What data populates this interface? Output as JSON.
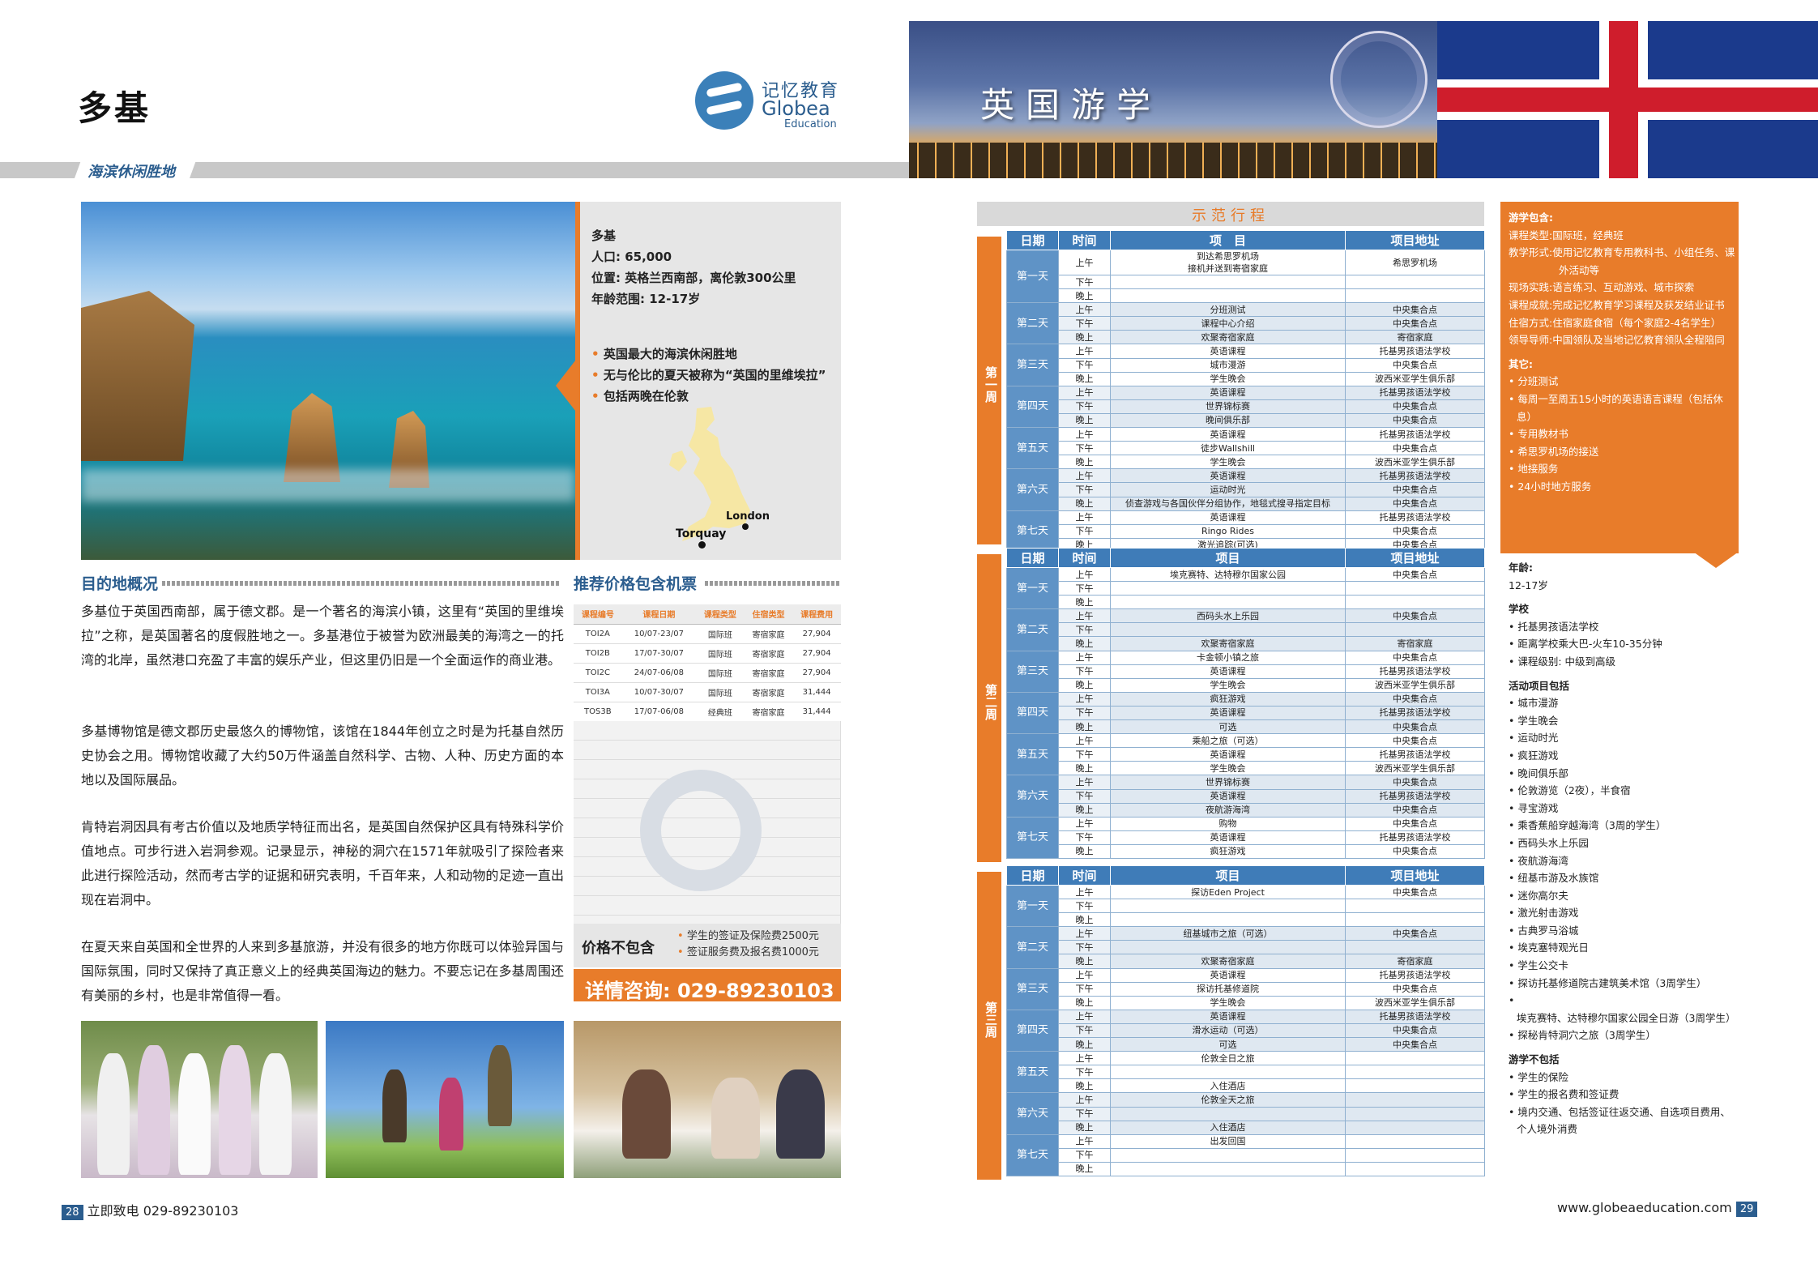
{
  "left": {
    "title": "多基",
    "logo": {
      "cn": "记忆教育",
      "en": "Globea",
      "sub": "Education"
    },
    "band_label": "海滨休闲胜地",
    "info": [
      "多基",
      "人口: 65,000",
      "位置: 英格兰西南部，离伦敦300公里",
      "年龄范围: 12-17岁"
    ],
    "highlights": [
      "英国最大的海滨休闲胜地",
      "无与伦比的夏天被称为“英国的里维埃拉”",
      "包括两晚在伦敦"
    ],
    "map_labels": {
      "london": "London",
      "torquay": "Torquay"
    },
    "overview_title": "目的地概况",
    "paragraphs": [
      "多基位于英国西南部，属于德文郡。是一个著名的海滨小镇，这里有“英国的里维埃拉”之称，是英国著名的度假胜地之一。多基港位于被誉为欧洲最美的海湾之一的托湾的北岸，虽然港口充盈了丰富的娱乐产业，但这里仍旧是一个全面运作的商业港。",
      "多基博物馆是德文郡历史最悠久的博物馆，该馆在1844年创立之时是为托基自然历史协会之用。博物馆收藏了大约50万件涵盖自然科学、古物、人种、历史方面的本地以及国际展品。",
      "肯特岩洞因具有考古价值以及地质学特征而出名，是英国自然保护区具有特殊科学价值地点。可步行进入岩洞参观。记录显示，神秘的洞穴在1571年就吸引了探险者来此进行探险活动，然而考古学的证据和研究表明，千百年来，人和动物的足迹一直出现在岩洞中。",
      "在夏天来自英国和全世界的人来到多基旅游，并没有很多的地方你既可以体验异国与国际氛围，同时又保持了真正意义上的经典英国海边的魅力。不要忘记在多基周围还有美丽的乡村，也是非常值得一看。"
    ],
    "price_title": "推荐价格包含机票",
    "price_headers": [
      "课程编号",
      "课程日期",
      "课程类型",
      "住宿类型",
      "课程费用"
    ],
    "price_rows": [
      [
        "TOI2A",
        "10/07-23/07",
        "国际班",
        "寄宿家庭",
        "27,904"
      ],
      [
        "TOI2B",
        "17/07-30/07",
        "国际班",
        "寄宿家庭",
        "27,904"
      ],
      [
        "TOI2C",
        "24/07-06/08",
        "国际班",
        "寄宿家庭",
        "27,904"
      ],
      [
        "TOI3A",
        "10/07-30/07",
        "国际班",
        "寄宿家庭",
        "31,444"
      ],
      [
        "TOS3B",
        "17/07-06/08",
        "经典班",
        "寄宿家庭",
        "31,444"
      ]
    ],
    "exclude_title": "价格不包含",
    "exclude_items": [
      "学生的签证及保险费2500元",
      "签证服务费及报名费1000元"
    ],
    "phone_cta": "详情咨询: 029-89230103",
    "page_num": "28",
    "footer": "立即致电 029-89230103"
  },
  "right": {
    "banner_title": "英国游学",
    "schedule_title": "示范行程",
    "headers": [
      "日期",
      "时间",
      "项　目",
      "项目地址"
    ],
    "headers2": [
      "日期",
      "时间",
      "项目",
      "项目地址"
    ],
    "slots": [
      "上午",
      "下午",
      "晚上"
    ],
    "days": [
      "第一天",
      "第二天",
      "第三天",
      "第四天",
      "第五天",
      "第六天",
      "第七天"
    ],
    "weeks": [
      {
        "label": "第一周",
        "rows": [
          [
            "到达希思罗机场\n接机并送到寄宿家庭",
            "希思罗机场",
            "",
            "",
            "",
            ""
          ],
          [
            "分班测试",
            "中央集合点",
            "课程中心介绍",
            "中央集合点",
            "欢聚寄宿家庭",
            "寄宿家庭"
          ],
          [
            "英语课程",
            "托基男孩语法学校",
            "城市漫游",
            "中央集合点",
            "学生晚会",
            "波西米亚学生俱乐部"
          ],
          [
            "英语课程",
            "托基男孩语法学校",
            "世界锦标赛",
            "中央集合点",
            "晚间俱乐部",
            "中央集合点"
          ],
          [
            "英语课程",
            "托基男孩语法学校",
            "徒步Wallshill",
            "中央集合点",
            "学生晚会",
            "波西米亚学生俱乐部"
          ],
          [
            "英语课程",
            "托基男孩语法学校",
            "运动时光",
            "中央集合点",
            "侦查游戏与各国伙伴分组协作，地毯式搜寻指定目标",
            "中央集合点"
          ],
          [
            "英语课程",
            "托基男孩语法学校",
            "Ringo Rides",
            "中央集合点",
            "激光追踪(可选)",
            "中央集合点"
          ]
        ]
      },
      {
        "label": "第二周",
        "rows": [
          [
            "埃克赛特、达特穆尔国家公园",
            "中央集合点",
            "",
            "",
            "",
            ""
          ],
          [
            "西码头水上乐园",
            "中央集合点",
            "",
            "",
            "欢聚寄宿家庭",
            "寄宿家庭"
          ],
          [
            "卡金顿小镇之旅",
            "中央集合点",
            "英语课程",
            "托基男孩语法学校",
            "学生晚会",
            "波西米亚学生俱乐部"
          ],
          [
            "疯狂游戏",
            "中央集合点",
            "英语课程",
            "托基男孩语法学校",
            "可选",
            "中央集合点"
          ],
          [
            "乘船之旅（可选）",
            "中央集合点",
            "英语课程",
            "托基男孩语法学校",
            "学生晚会",
            "波西米亚学生俱乐部"
          ],
          [
            "世界锦标赛",
            "中央集合点",
            "英语课程",
            "托基男孩语法学校",
            "夜航游海湾",
            "中央集合点"
          ],
          [
            "购物",
            "中央集合点",
            "英语课程",
            "托基男孩语法学校",
            "疯狂游戏",
            "中央集合点"
          ]
        ]
      },
      {
        "label": "第三周",
        "rows": [
          [
            "探访Eden Project",
            "中央集合点",
            "",
            "",
            "",
            ""
          ],
          [
            "纽基城市之旅（可选）",
            "中央集合点",
            "",
            "",
            "欢聚寄宿家庭",
            "寄宿家庭"
          ],
          [
            "英语课程",
            "托基男孩语法学校",
            "探访托基修道院",
            "中央集合点",
            "学生晚会",
            "波西米亚学生俱乐部"
          ],
          [
            "英语课程",
            "托基男孩语法学校",
            "滑水运动（可选）",
            "中央集合点",
            "可选",
            "中央集合点"
          ],
          [
            "伦敦全日之旅",
            "",
            "",
            "",
            "入住酒店",
            ""
          ],
          [
            "伦敦全天之旅",
            "",
            "",
            "",
            "入住酒店",
            ""
          ],
          [
            "出发回国",
            "",
            "",
            "",
            "",
            ""
          ]
        ]
      }
    ],
    "side_box": {
      "title": "游学包含:",
      "items": [
        [
          "课程类型:",
          "国际班，经典班"
        ],
        [
          "教学形式:",
          "使用记忆教育专用教科书、小组任务、课外活动等"
        ],
        [
          "现场实践:",
          "语言练习、互动游戏、城市探索"
        ],
        [
          "课程成就:",
          "完成记忆教育学习课程及获发结业证书"
        ],
        [
          "住宿方式:",
          "住宿家庭食宿（每个家庭2-4名学生）"
        ],
        [
          "领导导师:",
          "中国领队及当地记忆教育领队全程陪同"
        ]
      ],
      "other_title": "其它:",
      "other_items": [
        "分班测试",
        "每周一至周五15小时的英语语言课程（包括休息）",
        "专用教材书",
        "希思罗机场的接送",
        "地接服务",
        "24小时地方服务"
      ]
    },
    "age_title": "年龄:",
    "age_value": "12-17岁",
    "school_title": "学校",
    "school_items": [
      "托基男孩语法学校",
      "距离学校乘大巴-火车10-35分钟",
      "课程级别: 中级到高级"
    ],
    "activities_title": "活动项目包括",
    "activities": [
      "城市漫游",
      "学生晚会",
      "运动时光",
      "疯狂游戏",
      "晚间俱乐部",
      "伦敦游览（2夜），半食宿",
      "寻宝游戏",
      "乘香蕉船穿越海湾（3周的学生）",
      "西码头水上乐园",
      "夜航游海湾",
      "纽基市游及水族馆",
      "迷你高尔夫",
      "激光射击游戏",
      "古典罗马浴城",
      "埃克塞特观光日",
      "学生公交卡",
      "探访托基修道院古建筑美术馆（3周学生）",
      "埃克赛特、达特穆尔国家公园全日游（3周学生）",
      "探秘肯特洞穴之旅（3周学生）"
    ],
    "exclude_title": "游学不包括",
    "exclude_items": [
      "学生的保险",
      "学生的报名费和签证费",
      "境内交通、包括签证往返交通、自选项目费用、个人境外消费"
    ],
    "footer_url": "www.globeaeducation.com",
    "page_num": "29"
  },
  "colors": {
    "orange": "#e87c2a",
    "blue": "#3f7cb8",
    "dark_blue": "#2b5d8e"
  }
}
